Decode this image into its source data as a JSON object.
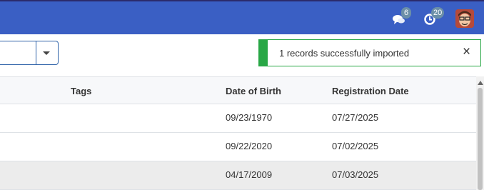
{
  "header": {
    "messages_count": "6",
    "activities_count": "20",
    "icons": [
      "chat-icon",
      "clock-icon",
      "user-avatar"
    ]
  },
  "toast": {
    "message": "1 records successfully imported",
    "close_label": "×",
    "color": "#28a745"
  },
  "table": {
    "columns": {
      "tags": "Tags",
      "dob": "Date of Birth",
      "registration": "Registration Date"
    },
    "rows": [
      {
        "tags": "",
        "dob": "09/23/1970",
        "registration": "07/27/2025"
      },
      {
        "tags": "",
        "dob": "09/22/2020",
        "registration": "07/02/2025"
      },
      {
        "tags": "",
        "dob": "04/17/2009",
        "registration": "07/03/2025"
      }
    ]
  },
  "colors": {
    "topbar": "#3a5fc4",
    "accent": "#2f62a8",
    "success": "#28a745"
  }
}
